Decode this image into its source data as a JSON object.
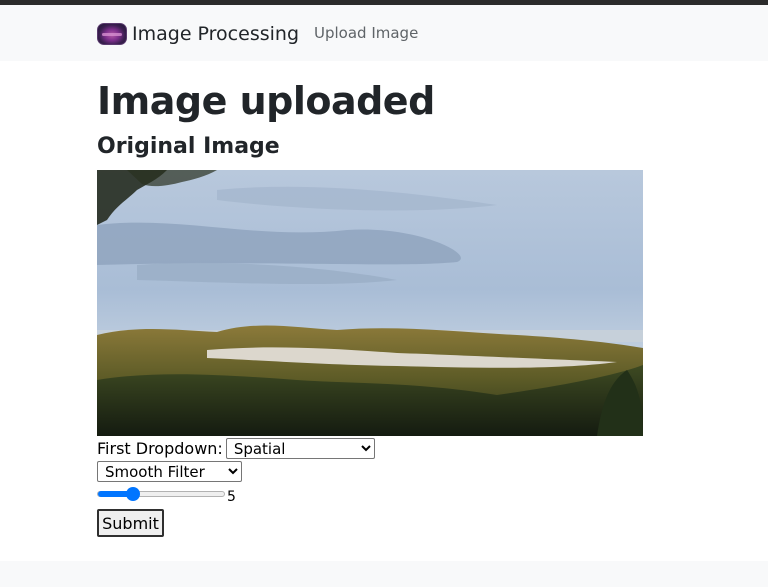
{
  "navbar": {
    "brand_text": "Image Processing",
    "brand_icon": "purple-image-logo",
    "link_upload": "Upload Image"
  },
  "main": {
    "title": "Image uploaded",
    "section_title": "Original Image",
    "image_alt": "Original Image"
  },
  "form": {
    "first_dropdown_label": "First Dropdown:",
    "first_dropdown_value": "Spatial",
    "second_dropdown_value": "Smooth Filter",
    "slider_value": "5",
    "slider_fraction": 0.28,
    "submit_label": "Submit"
  },
  "colors": {
    "accent": "#0075ff",
    "navbar_bg": "#f8f9fa",
    "text": "#212529"
  }
}
